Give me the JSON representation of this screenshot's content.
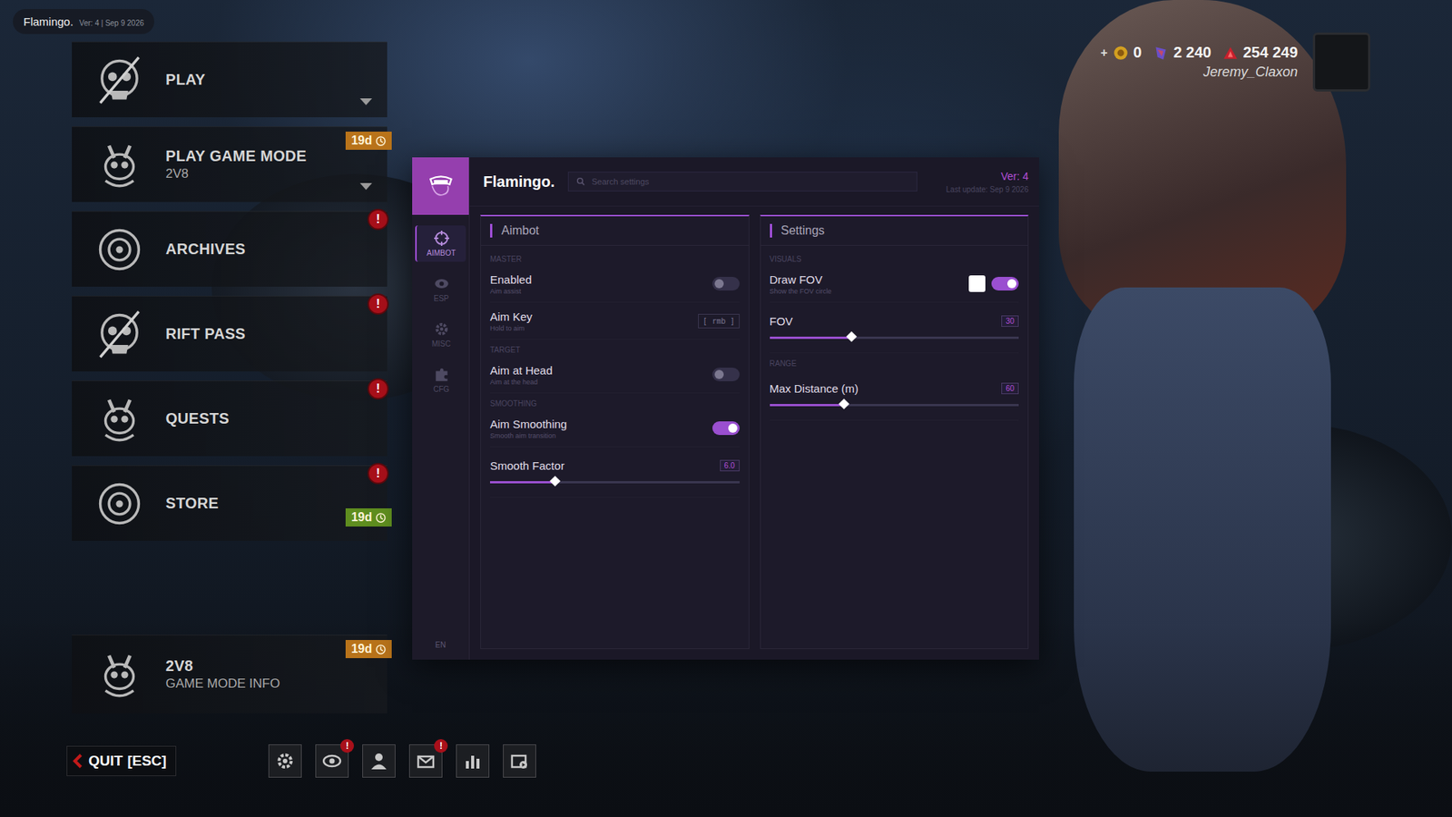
{
  "overlay_tag": {
    "name": "Flamingo.",
    "version": "Ver: 4 | Sep 9 2026"
  },
  "main_menu": {
    "alert_glyph": "!",
    "items": [
      {
        "title": "PLAY",
        "subtitle": "",
        "timer": "",
        "timer_color": "",
        "alert": false,
        "expandable": true
      },
      {
        "title": "PLAY GAME MODE",
        "subtitle": "2V8",
        "timer": "19d",
        "timer_color": "#b8731a",
        "alert": false,
        "expandable": true
      },
      {
        "title": "ARCHIVES",
        "subtitle": "",
        "timer": "",
        "timer_color": "",
        "alert": true,
        "expandable": false
      },
      {
        "title": "RIFT PASS",
        "subtitle": "",
        "timer": "",
        "timer_color": "",
        "alert": true,
        "expandable": false
      },
      {
        "title": "QUESTS",
        "subtitle": "",
        "timer": "",
        "timer_color": "",
        "alert": true,
        "expandable": false
      },
      {
        "title": "STORE",
        "subtitle": "",
        "timer": "19d",
        "timer_color": "#5f8e1f",
        "alert": true,
        "expandable": false
      }
    ],
    "info": {
      "title": "2V8",
      "subtitle": "GAME MODE INFO",
      "timer": "19d",
      "timer_color": "#b8731a",
      "alert": false,
      "expandable": false
    }
  },
  "quit": {
    "label": "QUIT",
    "key": "[ESC]"
  },
  "toolbar": [
    {
      "alert": false
    },
    {
      "alert": true
    },
    {
      "alert": false
    },
    {
      "alert": true
    },
    {
      "alert": false
    },
    {
      "alert": false
    }
  ],
  "currencies": [
    {
      "prefix": "+",
      "value": "0",
      "color": "#d4a020"
    },
    {
      "prefix": "",
      "value": "2 240",
      "color": "#6a4fc8"
    },
    {
      "prefix": "",
      "value": "254 249",
      "color": "#c8202c"
    }
  ],
  "player": {
    "name": "Jeremy_Claxon"
  },
  "cheat": {
    "title": "Flamingo.",
    "search_placeholder": "Search settings",
    "version": "Ver: 4",
    "last_update": "Last update: Sep 9 2026",
    "nav": [
      {
        "label": "AIMBOT",
        "selected": true
      },
      {
        "label": "ESP",
        "selected": false
      },
      {
        "label": "MISC",
        "selected": false
      },
      {
        "label": "CFG",
        "selected": false
      }
    ],
    "language": "EN",
    "panels": [
      {
        "title": "Aimbot",
        "sections": [
          {
            "heading": "MASTER",
            "rows": [
              {
                "kind": "toggle",
                "label": "Enabled",
                "hint": "Aim assist",
                "on": false
              },
              {
                "kind": "key",
                "label": "Aim Key",
                "hint": "Hold to aim",
                "value": "[ rmb ]"
              }
            ]
          },
          {
            "heading": "TARGET",
            "rows": [
              {
                "kind": "toggle",
                "label": "Aim at Head",
                "hint": "Aim at the head",
                "on": false
              }
            ]
          },
          {
            "heading": "SMOOTHING",
            "rows": [
              {
                "kind": "toggle",
                "label": "Aim Smoothing",
                "hint": "Smooth aim transition",
                "on": true
              },
              {
                "kind": "slider",
                "label": "Smooth Factor",
                "value": "6.0",
                "level": 0.26
              }
            ]
          }
        ]
      },
      {
        "title": "Settings",
        "sections": [
          {
            "heading": "VISUALS",
            "rows": [
              {
                "kind": "color_toggle",
                "label": "Draw FOV",
                "hint": "Show the FOV circle",
                "on": true,
                "swatch": "#ffffff"
              },
              {
                "kind": "slider",
                "label": "FOV",
                "value": "30",
                "level": 0.33
              }
            ]
          },
          {
            "heading": "RANGE",
            "rows": [
              {
                "kind": "slider",
                "label": "Max Distance (m)",
                "value": "60",
                "level": 0.3
              }
            ]
          }
        ]
      }
    ]
  }
}
